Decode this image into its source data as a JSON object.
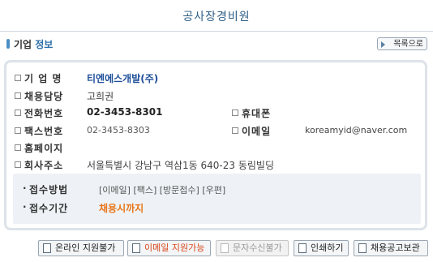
{
  "header": {
    "title": "공사장경비원"
  },
  "section": {
    "label_main": "기업 ",
    "label_accent": "정보",
    "back_button": "목록으로"
  },
  "company": {
    "name_label": "기 업 명",
    "name_value": "티엔에스개발(주)",
    "contact_label": "채용담당",
    "contact_value": "고희권",
    "phone_label": "전화번호",
    "phone_value": "02-3453-8301",
    "mobile_label": "휴대폰",
    "mobile_value": "",
    "fax_label": "팩스번호",
    "fax_value": "02-3453-8303",
    "email_label": "이메일",
    "email_value": "koreamyid@naver.com",
    "homepage_label": "홈페이지",
    "homepage_value": "",
    "address_label": "회사주소",
    "address_value": "서울특별시 강남구 역삼1동 640-23 동림빌딩"
  },
  "application": {
    "method_label": "접수방법",
    "method_value": "[이메일] [팩스] [방문접수] [우편]",
    "period_label": "접수기간",
    "period_value": "채용시까지"
  },
  "buttons": {
    "online": "온라인 지원불가",
    "email": "이메일 지원가능",
    "sms": "문자수신불가",
    "print": "인쇄하기",
    "ad_storage": "채용공고보관"
  }
}
